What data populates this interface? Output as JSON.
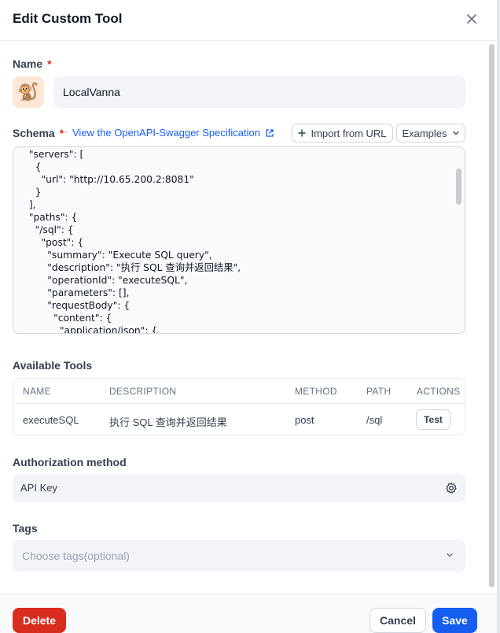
{
  "dialog": {
    "title": "Edit Custom Tool"
  },
  "name_field": {
    "label": "Name",
    "required_mark": "*",
    "avatar_emoji": "🐒",
    "value": "LocalVanna"
  },
  "schema": {
    "label": "Schema",
    "required_mark": "*",
    "spec_link": "View the OpenAPI-Swagger Specification",
    "import_button": "Import from URL",
    "examples_button": "Examples",
    "code": "  \"servers\": [\n    {\n      \"url\": \"http://10.65.200.2:8081\"\n    }\n  ],\n  \"paths\": {\n    \"/sql\": {\n      \"post\": {\n        \"summary\": \"Execute SQL query\",\n        \"description\": \"执行 SQL 查询并返回结果\",\n        \"operationId\": \"executeSQL\",\n        \"parameters\": [],\n        \"requestBody\": {\n          \"content\": {\n            \"application/json\": {"
  },
  "tools": {
    "label": "Available Tools",
    "columns": [
      "NAME",
      "DESCRIPTION",
      "METHOD",
      "PATH",
      "ACTIONS"
    ],
    "rows": [
      {
        "name": "executeSQL",
        "description": "执行 SQL 查询并返回结果",
        "method": "post",
        "path": "/sql",
        "action": "Test"
      }
    ]
  },
  "authorization": {
    "label": "Authorization method",
    "value": "API Key"
  },
  "tags": {
    "label": "Tags",
    "placeholder": "Choose tags(optional)"
  },
  "footer": {
    "delete": "Delete",
    "cancel": "Cancel",
    "save": "Save"
  },
  "colors": {
    "primary": "#155eef",
    "danger": "#d92d20",
    "field_bg": "#f2f4f7"
  },
  "icons": [
    "close-icon",
    "external-link-icon",
    "plus-icon",
    "chevron-down-icon",
    "gear-icon",
    "monkey-avatar-icon"
  ]
}
